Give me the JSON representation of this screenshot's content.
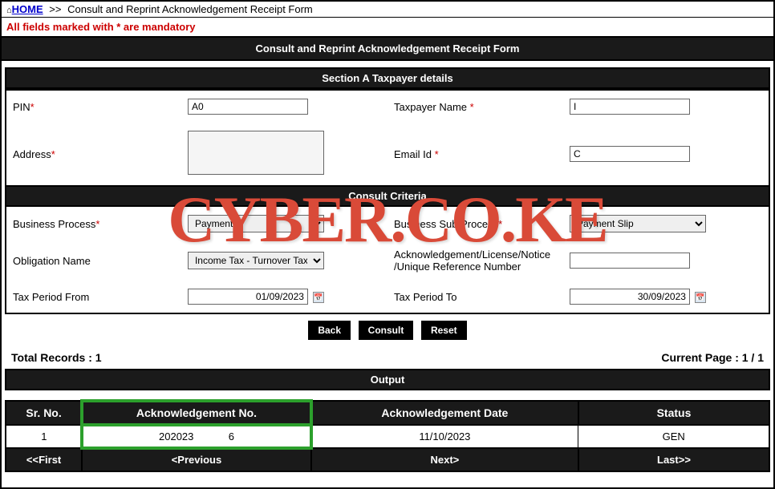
{
  "breadcrumb": {
    "home": "HOME",
    "sep": ">>",
    "current": "Consult and Reprint Acknowledgement Receipt Form"
  },
  "mandatory_note": "All fields marked with * are mandatory",
  "page_title": "Consult and Reprint Acknowledgement Receipt Form",
  "section_a": {
    "title": "Section A Taxpayer details",
    "fields": {
      "pin_label": "PIN",
      "pin_value": "A0",
      "taxpayer_name_label": "Taxpayer Name ",
      "taxpayer_name_value": "I",
      "address_label": "Address",
      "address_value": "",
      "email_label": "Email Id ",
      "email_value": "C"
    }
  },
  "consult_criteria": {
    "title": "Consult Criteria",
    "fields": {
      "business_process_label": "Business Process",
      "business_process_value": "Payment",
      "business_sub_process_label": "Business Sub Process",
      "business_sub_process_value": "Payment Slip",
      "obligation_name_label": "Obligation Name",
      "obligation_name_value": "Income Tax - Turnover Tax",
      "ack_ref_label": "Acknowledgement/License/Notice /Unique Reference Number",
      "ack_ref_value": "",
      "tax_period_from_label": "Tax Period From",
      "tax_period_from_value": "01/09/2023",
      "tax_period_to_label": "Tax Period To",
      "tax_period_to_value": "30/09/2023"
    }
  },
  "buttons": {
    "back": "Back",
    "consult": "Consult",
    "reset": "Reset"
  },
  "records": {
    "total_label": "Total Records : 1",
    "page_label": "Current Page : 1 / 1"
  },
  "output": {
    "title": "Output",
    "headers": {
      "srno": "Sr. No.",
      "ackno": "Acknowledgement No.",
      "ackdate": "Acknowledgement Date",
      "status": "Status"
    },
    "rows": [
      {
        "srno": "1",
        "ackno": "202023            6",
        "ackdate": "11/10/2023",
        "status": "GEN"
      }
    ],
    "nav": {
      "first": "<<First",
      "prev": "<Previous",
      "next": "Next>",
      "last": "Last>>"
    }
  },
  "watermark": "CYBER.CO.KE"
}
